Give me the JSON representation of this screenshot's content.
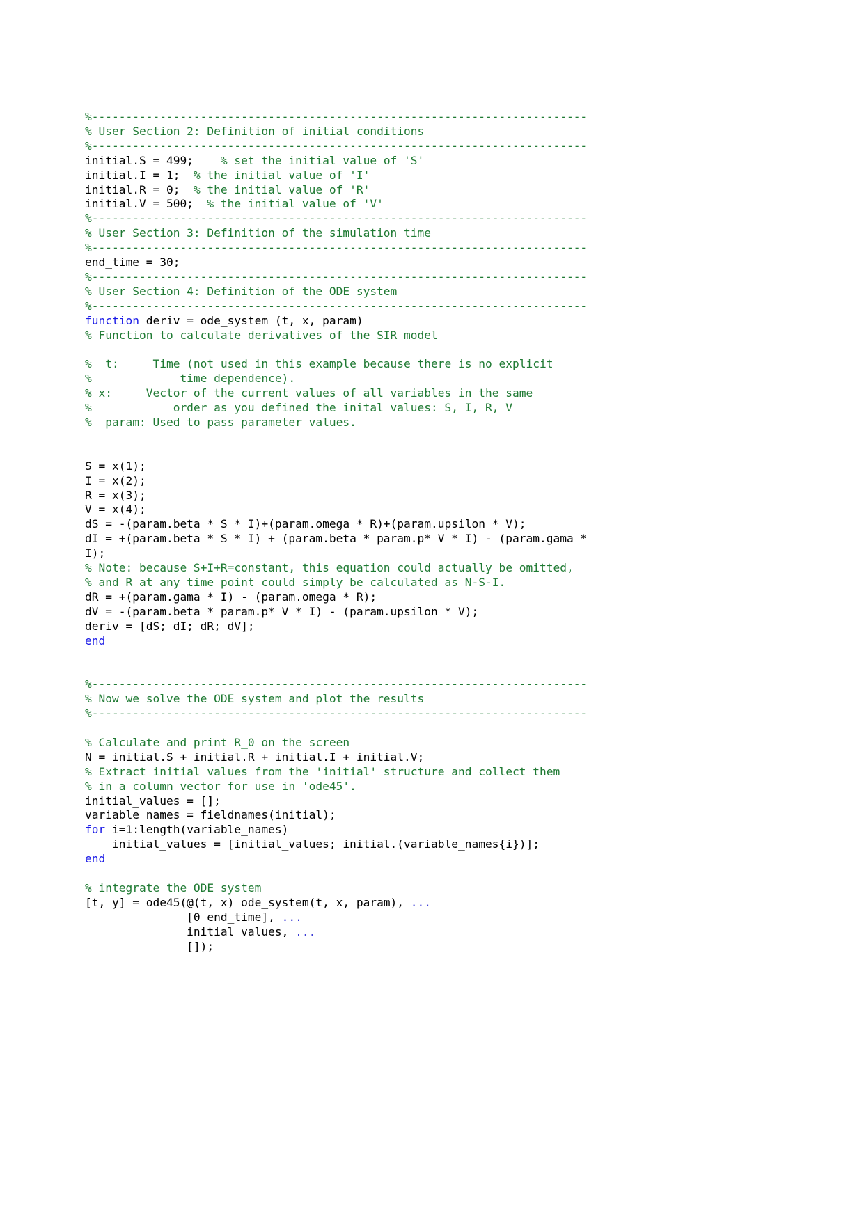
{
  "document": {
    "kind": "matlab-code-listing",
    "language": "MATLAB",
    "background_color": "#ffffff",
    "comment_color": "#1f7a33",
    "keyword_color": "#1a1ae6",
    "code_color": "#000000",
    "continuation_color": "#3b3bd6"
  },
  "code": {
    "lines": [
      {
        "id": "l001",
        "type": "comment",
        "text": "%-------------------------------------------------------------------------"
      },
      {
        "id": "l002",
        "type": "comment",
        "text": "% User Section 2: Definition of initial conditions"
      },
      {
        "id": "l003",
        "type": "comment",
        "text": "%-------------------------------------------------------------------------"
      },
      {
        "id": "l004",
        "type": "mixed",
        "code": "initial.S = 499;",
        "comment": "    % set the initial value of 'S'"
      },
      {
        "id": "l005",
        "type": "mixed",
        "code": "initial.I = 1;",
        "comment": "  % the initial value of 'I'"
      },
      {
        "id": "l006",
        "type": "mixed",
        "code": "initial.R = 0;",
        "comment": "  % the initial value of 'R'"
      },
      {
        "id": "l007",
        "type": "mixed",
        "code": "initial.V = 500;",
        "comment": "  % the initial value of 'V'"
      },
      {
        "id": "l008",
        "type": "comment",
        "text": "%-------------------------------------------------------------------------"
      },
      {
        "id": "l009",
        "type": "comment",
        "text": "% User Section 3: Definition of the simulation time"
      },
      {
        "id": "l010",
        "type": "comment",
        "text": "%-------------------------------------------------------------------------"
      },
      {
        "id": "l011",
        "type": "code",
        "text": "end_time = 30;"
      },
      {
        "id": "l012",
        "type": "comment",
        "text": "%-------------------------------------------------------------------------"
      },
      {
        "id": "l013",
        "type": "comment",
        "text": "% User Section 4: Definition of the ODE system"
      },
      {
        "id": "l014",
        "type": "comment",
        "text": "%-------------------------------------------------------------------------"
      },
      {
        "id": "l015",
        "type": "keyword-line",
        "keyword": "function",
        "rest": " deriv = ode_system (t, x, param)"
      },
      {
        "id": "l016",
        "type": "comment",
        "text": "% Function to calculate derivatives of the SIR model"
      },
      {
        "id": "l017",
        "type": "blank",
        "text": ""
      },
      {
        "id": "l018",
        "type": "comment",
        "text": "%  t:     Time (not used in this example because there is no explicit"
      },
      {
        "id": "l019",
        "type": "comment",
        "text": "%             time dependence)."
      },
      {
        "id": "l020",
        "type": "comment",
        "text": "% x:     Vector of the current values of all variables in the same"
      },
      {
        "id": "l021",
        "type": "comment",
        "text": "%            order as you defined the inital values: S, I, R, V"
      },
      {
        "id": "l022",
        "type": "comment",
        "text": "%  param: Used to pass parameter values."
      },
      {
        "id": "l023",
        "type": "blank",
        "text": ""
      },
      {
        "id": "l024",
        "type": "blank",
        "text": ""
      },
      {
        "id": "l025",
        "type": "code",
        "text": "S = x(1);"
      },
      {
        "id": "l026",
        "type": "code",
        "text": "I = x(2);"
      },
      {
        "id": "l027",
        "type": "code",
        "text": "R = x(3);"
      },
      {
        "id": "l028",
        "type": "code",
        "text": "V = x(4);"
      },
      {
        "id": "l029",
        "type": "code",
        "text": "dS = -(param.beta * S * I)+(param.omega * R)+(param.upsilon * V);"
      },
      {
        "id": "l030",
        "type": "code",
        "text": "dI = +(param.beta * S * I) + (param.beta * param.p* V * I) - (param.gama *"
      },
      {
        "id": "l031",
        "type": "code",
        "text": "I);"
      },
      {
        "id": "l032",
        "type": "comment",
        "text": "% Note: because S+I+R=constant, this equation could actually be omitted,"
      },
      {
        "id": "l033",
        "type": "comment",
        "text": "% and R at any time point could simply be calculated as N-S-I."
      },
      {
        "id": "l034",
        "type": "code",
        "text": "dR = +(param.gama * I) - (param.omega * R);"
      },
      {
        "id": "l035",
        "type": "code",
        "text": "dV = -(param.beta * param.p* V * I) - (param.upsilon * V);"
      },
      {
        "id": "l036",
        "type": "code",
        "text": "deriv = [dS; dI; dR; dV];"
      },
      {
        "id": "l037",
        "type": "keyword",
        "text": "end"
      },
      {
        "id": "l038",
        "type": "blank",
        "text": ""
      },
      {
        "id": "l039",
        "type": "blank",
        "text": ""
      },
      {
        "id": "l040",
        "type": "comment",
        "text": "%-------------------------------------------------------------------------"
      },
      {
        "id": "l041",
        "type": "comment",
        "text": "% Now we solve the ODE system and plot the results"
      },
      {
        "id": "l042",
        "type": "comment",
        "text": "%-------------------------------------------------------------------------"
      },
      {
        "id": "l043",
        "type": "blank",
        "text": ""
      },
      {
        "id": "l044",
        "type": "comment",
        "text": "% Calculate and print R_0 on the screen"
      },
      {
        "id": "l045",
        "type": "code",
        "text": "N = initial.S + initial.R + initial.I + initial.V;"
      },
      {
        "id": "l046",
        "type": "comment",
        "text": "% Extract initial values from the 'initial' structure and collect them"
      },
      {
        "id": "l047",
        "type": "comment",
        "text": "% in a column vector for use in 'ode45'."
      },
      {
        "id": "l048",
        "type": "code",
        "text": "initial_values = [];"
      },
      {
        "id": "l049",
        "type": "code",
        "text": "variable_names = fieldnames(initial);"
      },
      {
        "id": "l050",
        "type": "keyword-line",
        "keyword": "for",
        "rest": " i=1:length(variable_names)"
      },
      {
        "id": "l051",
        "type": "code",
        "text": "    initial_values = [initial_values; initial.(variable_names{i})];"
      },
      {
        "id": "l052",
        "type": "keyword",
        "text": "end"
      },
      {
        "id": "l053",
        "type": "blank",
        "text": ""
      },
      {
        "id": "l054",
        "type": "comment",
        "text": "% integrate the ODE system"
      },
      {
        "id": "l055",
        "type": "cont-line",
        "code": "[t, y] = ode45(@(t, x) ode_system(t, x, param), ",
        "cont": "..."
      },
      {
        "id": "l056",
        "type": "cont-line",
        "code": "               [0 end_time], ",
        "cont": "..."
      },
      {
        "id": "l057",
        "type": "cont-line",
        "code": "               initial_values, ",
        "cont": "..."
      },
      {
        "id": "l058",
        "type": "code",
        "text": "               []);"
      }
    ]
  }
}
